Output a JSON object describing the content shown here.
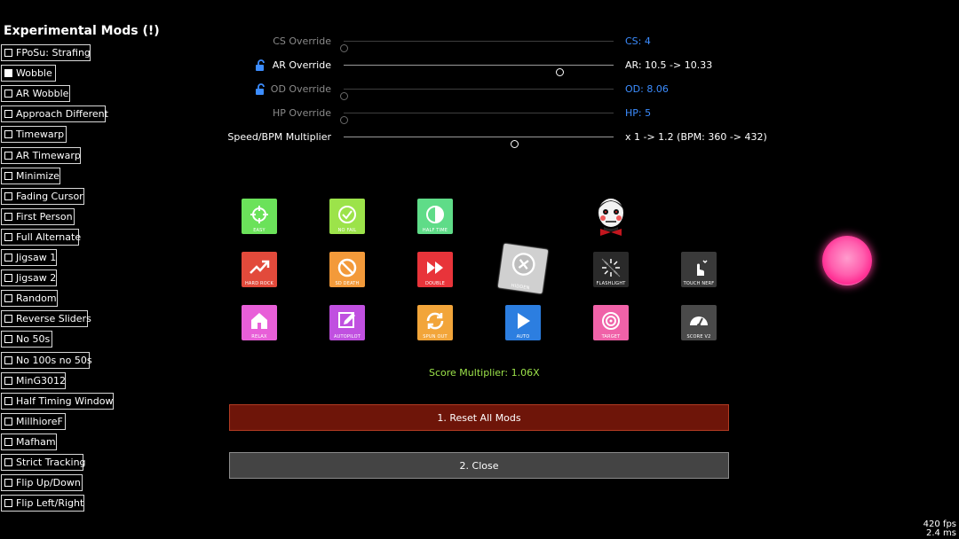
{
  "experimental": {
    "title": "Experimental Mods (!)",
    "items": [
      {
        "label": "FPoSu: Strafing",
        "checked": false
      },
      {
        "label": "Wobble",
        "checked": true
      },
      {
        "label": "AR Wobble",
        "checked": false
      },
      {
        "label": "Approach Different",
        "checked": false
      },
      {
        "label": "Timewarp",
        "checked": false
      },
      {
        "label": "AR Timewarp",
        "checked": false
      },
      {
        "label": "Minimize",
        "checked": false
      },
      {
        "label": "Fading Cursor",
        "checked": false
      },
      {
        "label": "First Person",
        "checked": false
      },
      {
        "label": "Full Alternate",
        "checked": false
      },
      {
        "label": "Jigsaw 1",
        "checked": false
      },
      {
        "label": "Jigsaw 2",
        "checked": false
      },
      {
        "label": "Random",
        "checked": false
      },
      {
        "label": "Reverse Sliders",
        "checked": false
      },
      {
        "label": "No 50s",
        "checked": false
      },
      {
        "label": "No 100s no 50s",
        "checked": false
      },
      {
        "label": "MinG3012",
        "checked": false
      },
      {
        "label": "Half Timing Window",
        "checked": false
      },
      {
        "label": "MillhioreF",
        "checked": false
      },
      {
        "label": "Mafham",
        "checked": false
      },
      {
        "label": "Strict Tracking",
        "checked": false
      },
      {
        "label": "Flip Up/Down",
        "checked": false
      },
      {
        "label": "Flip Left/Right",
        "checked": false
      }
    ]
  },
  "overrides": [
    {
      "label": "CS Override",
      "value": "CS: 4",
      "level": 0.0,
      "active": false,
      "locked": false,
      "value_color": "blue"
    },
    {
      "label": "AR Override",
      "value": "AR: 10.5 -> 10.33",
      "level": 0.8,
      "active": true,
      "locked": true,
      "value_color": "white"
    },
    {
      "label": "OD Override",
      "value": "OD: 8.06",
      "level": 0.0,
      "active": false,
      "locked": true,
      "value_color": "blue"
    },
    {
      "label": "HP Override",
      "value": "HP: 5",
      "level": 0.0,
      "active": false,
      "locked": false,
      "value_color": "blue"
    },
    {
      "label": "Speed/BPM Multiplier",
      "value": "x 1 -> 1.2  (BPM: 360 -> 432)",
      "level": 0.63,
      "active": true,
      "locked": false,
      "value_color": "white"
    }
  ],
  "mods": [
    {
      "label": "EASY",
      "color": "#6be25a",
      "icon": "crosshair-icon"
    },
    {
      "label": "NO FAIL",
      "color": "#9ce34a",
      "icon": "check-circle-icon"
    },
    {
      "label": "HALF TIME",
      "color": "#5fdc88",
      "icon": "half-circle-icon"
    },
    {
      "label": "HARD ROCK",
      "color": "#e24a3b",
      "icon": "trend-up-icon"
    },
    {
      "label": "SD DEATH",
      "color": "#f39a3a",
      "icon": "prohibit-icon"
    },
    {
      "label": "DOUBLE",
      "color": "#e8343a",
      "icon": "fast-forward-icon"
    },
    {
      "label": "HIDDEN",
      "color": "#d0d0d0",
      "icon": "x-circle-icon"
    },
    {
      "label": "FLASHLIGHT",
      "color": "#2a2a2a",
      "icon": "flash-icon"
    },
    {
      "label": "TOUCH NERF",
      "color": "#3a3a3a",
      "icon": "touch-icon"
    },
    {
      "label": "RELAX",
      "color": "#e85fd8",
      "icon": "home-icon"
    },
    {
      "label": "AUTOPILOT",
      "color": "#c050e0",
      "icon": "edit-icon"
    },
    {
      "label": "SPUN OUT",
      "color": "#f2a53a",
      "icon": "refresh-icon"
    },
    {
      "label": "AUTO",
      "color": "#2c7ee0",
      "icon": "play-icon"
    },
    {
      "label": "TARGET",
      "color": "#f062a8",
      "icon": "target-icon"
    },
    {
      "label": "SCORE V2",
      "color": "#4a4a4a",
      "icon": "gauge-icon"
    }
  ],
  "score_multiplier": "Score Multiplier: 1.06X",
  "buttons": {
    "reset": "1. Reset All Mods",
    "close": "2. Close"
  },
  "stats": {
    "fps": "420 fps",
    "frame_time": "2.4 ms"
  }
}
